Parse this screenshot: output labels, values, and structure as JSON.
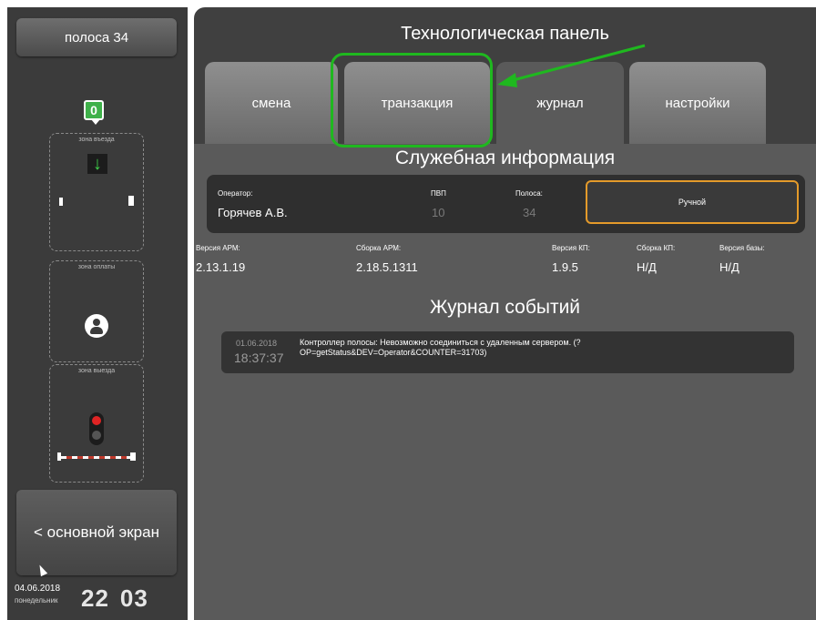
{
  "sidebar": {
    "lane_label": "полоса 34",
    "counter": "0",
    "zone_entry_label": "зона въезда",
    "zone_payment_label": "зона оплаты",
    "zone_exit_label": "зона выезда",
    "main_screen_label": "< основной экран",
    "date": "04.06.2018",
    "weekday": "понедельник",
    "clock_hours": "22",
    "clock_minutes": "03"
  },
  "panel": {
    "title": "Технологическая панель",
    "tabs": [
      {
        "label": "смена"
      },
      {
        "label": "транзакция"
      },
      {
        "label": "журнал"
      },
      {
        "label": "настройки"
      }
    ],
    "active_tab": "журнал",
    "service_title": "Служебная информация",
    "operator_label": "Оператор:",
    "operator_value": "Горячев А.В.",
    "pvp_label": "ПВП",
    "pvp_value": "10",
    "lane_label": "Полоса:",
    "lane_value": "34",
    "mode_value": "Ручной",
    "versions": [
      {
        "label": "Версия АРМ:",
        "value": "2.13.1.19"
      },
      {
        "label": "Сборка АРМ:",
        "value": "2.18.5.1311"
      },
      {
        "label": "Версия КП:",
        "value": "1.9.5"
      },
      {
        "label": "Сборка КП:",
        "value": "Н/Д"
      },
      {
        "label": "Версия базы:",
        "value": "Н/Д"
      }
    ],
    "journal_title": "Журнал событий",
    "events": [
      {
        "date": "01.06.2018",
        "time": "18:37:37",
        "text": "Контроллер полосы: Невозможно соединиться с удаленным сервером. (? OP=getStatus&DEV=Operator&COUNTER=31703)"
      }
    ]
  },
  "colors": {
    "accent_orange": "#e49a2a",
    "annotation_green": "#1fb81f",
    "status_green": "#3fb14a",
    "stop_red": "#e02424"
  }
}
